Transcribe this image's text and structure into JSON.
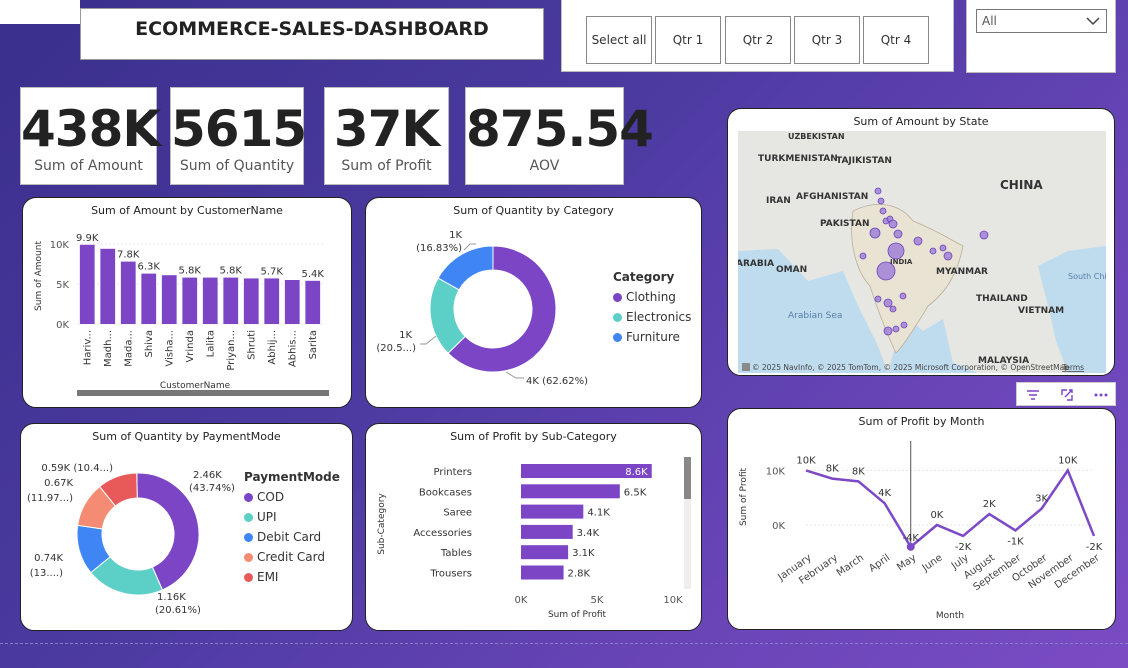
{
  "header": {
    "title": "ECOMMERCE-SALES-DASHBOARD",
    "back_icon": "arrow-left-circle-icon"
  },
  "quarter_slicer": {
    "buttons": [
      "Select all",
      "Qtr 1",
      "Qtr 2",
      "Qtr 3",
      "Qtr 4"
    ]
  },
  "dropdown": {
    "value": "All",
    "icon": "chevron-down-icon"
  },
  "kpis": [
    {
      "value": "438K",
      "label": "Sum of Amount"
    },
    {
      "value": "5615",
      "label": "Sum of Quantity"
    },
    {
      "value": "37K",
      "label": "Sum of Profit"
    },
    {
      "value": "875.54",
      "label": "AOV"
    }
  ],
  "map": {
    "title": "Sum of Amount by State",
    "labels": [
      "UZBEKISTAN",
      "TURKMENISTAN",
      "TAJIKISTAN",
      "IRAN",
      "AFGHANISTAN",
      "PAKISTAN",
      "CHINA",
      "ARABIA",
      "OMAN",
      "INDIA",
      "MYANMAR",
      "THAILAND",
      "VIETNAM",
      "Arabian Sea",
      "South China Sea",
      "MALAYSIA"
    ],
    "attribution": "© 2025 NavInfo, © 2025 TomTom, © 2025 Microsoft Corporation, © OpenStreetMap",
    "terms": "Terms",
    "logo": "bing-logo-icon"
  },
  "visual_header": {
    "icons": [
      "filter-icon",
      "focus-mode-icon",
      "more-options-icon"
    ]
  },
  "colors": {
    "purple": "#7b45c6",
    "teal": "#5ccfc6",
    "blue": "#3f86f4",
    "salmon": "#f48b73",
    "red": "#e85a5a",
    "line_purple": "#7c49c7"
  },
  "chart_data": [
    {
      "type": "bar",
      "title": "Sum of Amount by CustomerName",
      "xlabel": "CustomerName",
      "ylabel": "Sum of Amount",
      "categories": [
        "Hariv...",
        "Madh...",
        "Mada...",
        "Shiva",
        "Visha...",
        "Vrinda",
        "Lalita",
        "Priyan...",
        "Shruti",
        "Abhij...",
        "Abhis...",
        "Sarita"
      ],
      "values": [
        9900,
        9400,
        7800,
        6300,
        6100,
        5800,
        5800,
        5800,
        5700,
        5700,
        5500,
        5400
      ],
      "data_labels": [
        "9.9K",
        "",
        "7.8K",
        "6.3K",
        "",
        "5.8K",
        "",
        "5.8K",
        "",
        "5.7K",
        "",
        "5.4K"
      ],
      "y_ticks": [
        "0K",
        "5K",
        "10K"
      ],
      "ylim": [
        0,
        11000
      ]
    },
    {
      "type": "pie",
      "title": "Sum of Quantity by Category",
      "legend_title": "Category",
      "legend": "right",
      "slices": [
        {
          "name": "Clothing",
          "value": 3516,
          "label": "4K (62.62%)"
        },
        {
          "name": "Electronics",
          "value": 1154,
          "label_line1": "1K",
          "label_line2": "(20.5...)"
        },
        {
          "name": "Furniture",
          "value": 945,
          "label_line1": "1K",
          "label_line2": "(16.83%)"
        }
      ]
    },
    {
      "type": "pie",
      "title": "Sum of Quantity by PaymentMode",
      "legend_title": "PaymentMode",
      "legend": "right",
      "slices": [
        {
          "name": "COD",
          "value": 2460,
          "label_line1": "2.46K",
          "label_line2": "(43.74%)"
        },
        {
          "name": "UPI",
          "value": 1160,
          "label_line1": "1.16K",
          "label_line2": "(20.61%)"
        },
        {
          "name": "Debit Card",
          "value": 740,
          "label_line1": "0.74K",
          "label_line2": "(13....)"
        },
        {
          "name": "Credit Card",
          "value": 670,
          "label_line1": "0.67K",
          "label_line2": "(11.97...)"
        },
        {
          "name": "EMI",
          "value": 590,
          "label_line1": "0.59K (10.4...)",
          "label_line2": ""
        }
      ]
    },
    {
      "type": "bar",
      "orientation": "horizontal",
      "title": "Sum of Profit by Sub-Category",
      "xlabel": "Sum of Profit",
      "ylabel": "Sub-Category",
      "categories": [
        "Printers",
        "Bookcases",
        "Saree",
        "Accessories",
        "Tables",
        "Trousers"
      ],
      "values": [
        8600,
        6500,
        4100,
        3400,
        3100,
        2800
      ],
      "data_labels": [
        "8.6K",
        "6.5K",
        "4.1K",
        "3.4K",
        "3.1K",
        "2.8K"
      ],
      "x_ticks": [
        "0K",
        "5K",
        "10K"
      ],
      "xlim": [
        0,
        10000
      ]
    },
    {
      "type": "line",
      "title": "Sum of Profit by Month",
      "xlabel": "Month",
      "ylabel": "Sum of Profit",
      "categories": [
        "January",
        "February",
        "March",
        "April",
        "May",
        "June",
        "July",
        "August",
        "September",
        "October",
        "November",
        "December"
      ],
      "values": [
        10000,
        8500,
        8000,
        4000,
        -4000,
        0,
        -2000,
        2000,
        -1000,
        3000,
        10000,
        -2000
      ],
      "data_labels": [
        "10K",
        "8K",
        "8K",
        "4K",
        "-4K",
        "0K",
        "-2K",
        "2K",
        "-1K",
        "3K",
        "10K",
        "-2K"
      ],
      "y_ticks": [
        "0K",
        "10K"
      ],
      "ylim": [
        -5000,
        12000
      ]
    }
  ]
}
